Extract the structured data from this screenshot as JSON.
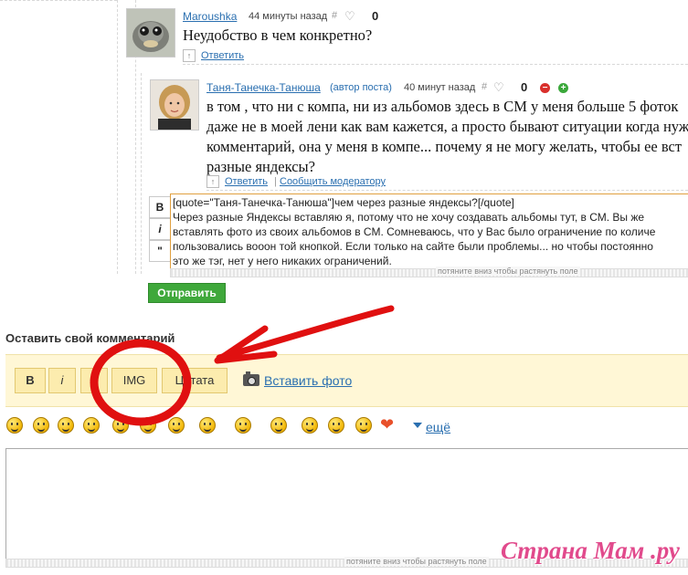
{
  "comment1": {
    "username": "Maroushka",
    "time": "44 минуты назад",
    "hash": "#",
    "heart": "♡",
    "score": "0",
    "text": "Неудобство в чем конкретно?",
    "reply_label": "Ответить"
  },
  "comment2": {
    "username": "Таня-Танечка-Танюша",
    "author_badge": "(автор поста)",
    "time": "40 минут назад",
    "hash": "#",
    "heart": "♡",
    "score": "0",
    "minus": "−",
    "plus": "+",
    "text_lines": [
      "в том , что ни с компа, ни из альбомов здесь в СМ у меня больше 5 фоток",
      "даже не в моей лени как вам кажется, а просто бывают ситуации когда нуж",
      "комментарий, она у меня в компе... почему я не могу желать, чтобы ее вст",
      "разные яндексы?"
    ],
    "reply_label": "Ответить",
    "separator": "|",
    "report_label": "Сообщить модератору"
  },
  "reply_editor": {
    "bold": "B",
    "italic": "i",
    "quote": "\"",
    "lines": [
      "[quote=\"Таня-Танечка-Танюша\"]чем через разные яндексы?[/quote]",
      "Через разные Яндексы вставляю я, потому что не хочу создавать альбомы тут, в СМ. Вы же",
      "вставлять фото из своих альбомов в СМ. Сомневаюсь, что у Вас было ограничение по количе",
      "пользовались вооон  той кнопкой. Если только на сайте были проблемы... но чтобы постоянно",
      "это же тэг, нет у него никаких ограничений."
    ],
    "resize_hint": "потяните вниз чтобы растянуть поле",
    "submit_label": "Отправить"
  },
  "new_comment": {
    "heading": "Оставить свой комментарий",
    "toolbar": {
      "bold": "B",
      "italic": "i",
      "strike": "S",
      "img": "IMG",
      "quote": "Цитата",
      "insert_photo": "Вставить фото"
    },
    "more_label": "ещё",
    "resize_hint": "потяните вниз чтобы растянуть поле"
  },
  "watermark": "Страна Мам .ру",
  "colors": {
    "link": "#2a6fb0",
    "submit_green": "#3fa83b",
    "toolbar_bg": "#fff7d6",
    "annotation_red": "#e01010"
  }
}
